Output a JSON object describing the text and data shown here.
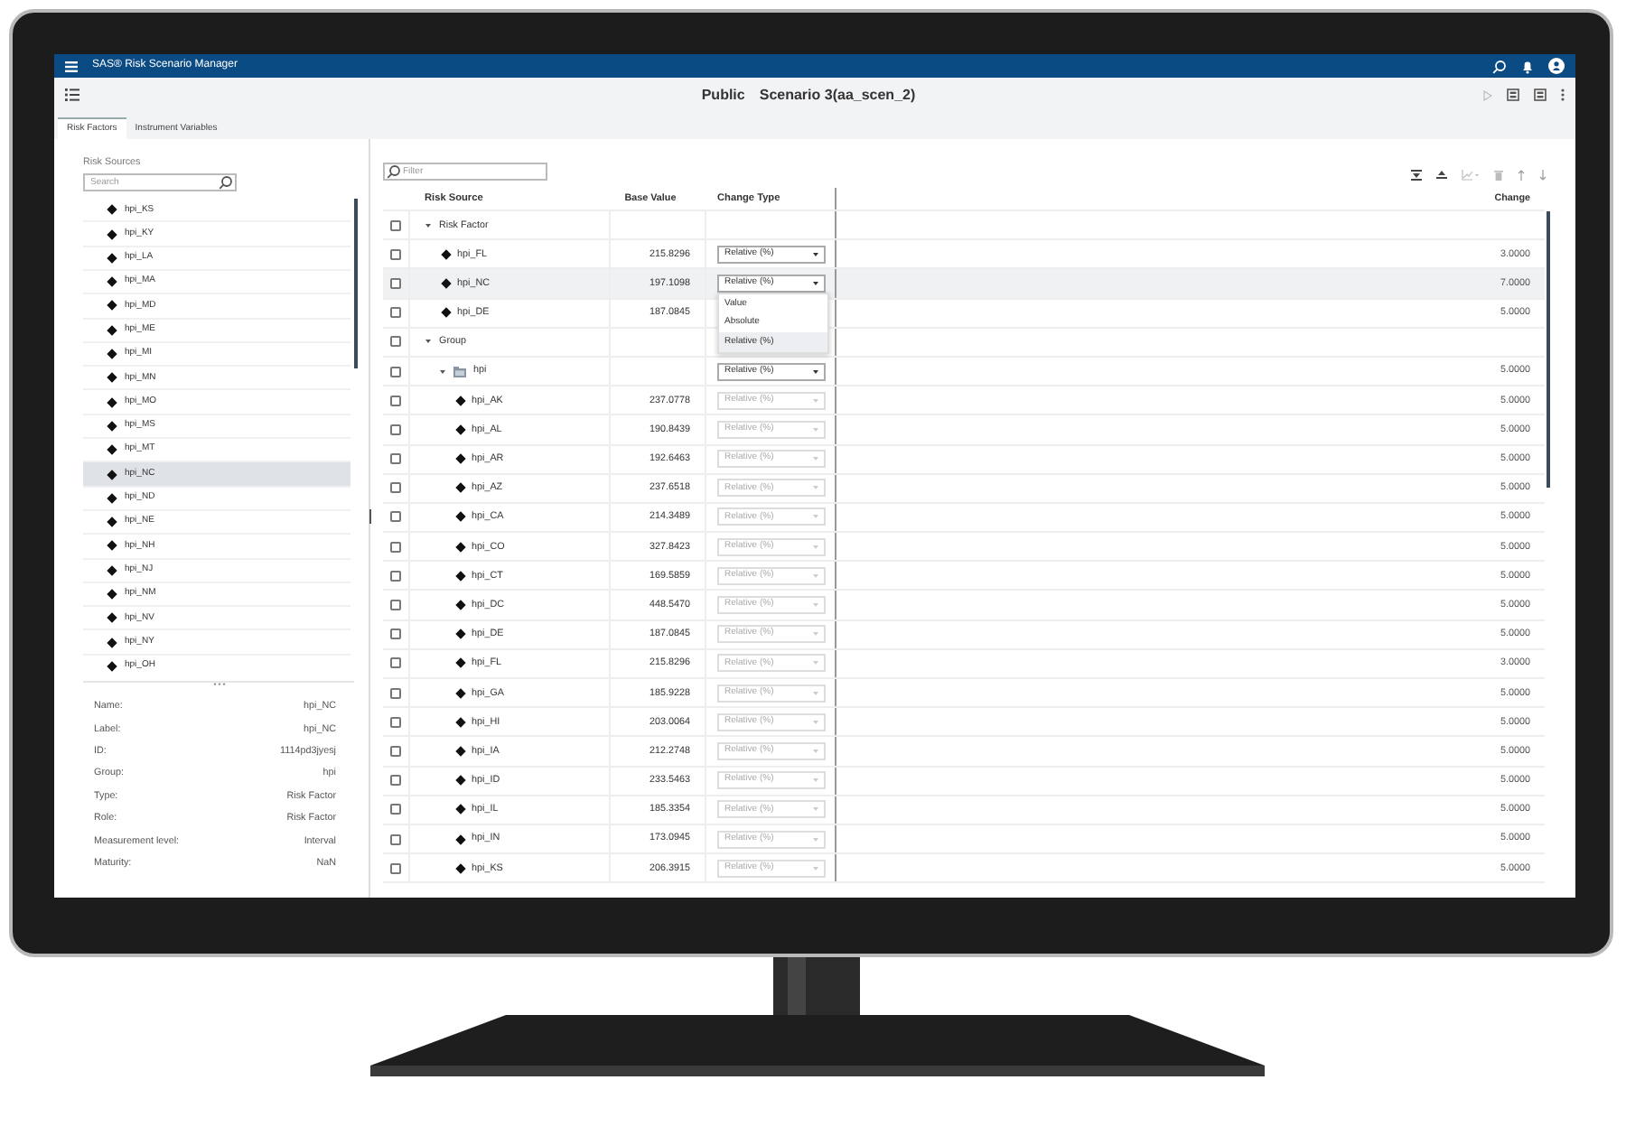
{
  "app_bar": {
    "title": "SAS® Risk Scenario Manager"
  },
  "header": {
    "visibility": "Public",
    "title": "Scenario 3(aa_scen_2)"
  },
  "tabs": [
    {
      "label": "Risk Factors",
      "selected": true
    },
    {
      "label": "Instrument Variables",
      "selected": false
    }
  ],
  "risk_sources": {
    "heading": "Risk Sources",
    "search": {
      "placeholder": "Search"
    },
    "items": [
      {
        "label": "hpi_KS",
        "selected": false
      },
      {
        "label": "hpi_KY",
        "selected": false
      },
      {
        "label": "hpi_LA",
        "selected": false
      },
      {
        "label": "hpi_MA",
        "selected": false
      },
      {
        "label": "hpi_MD",
        "selected": false
      },
      {
        "label": "hpi_ME",
        "selected": false
      },
      {
        "label": "hpi_MI",
        "selected": false
      },
      {
        "label": "hpi_MN",
        "selected": false
      },
      {
        "label": "hpi_MO",
        "selected": false
      },
      {
        "label": "hpi_MS",
        "selected": false
      },
      {
        "label": "hpi_MT",
        "selected": false
      },
      {
        "label": "hpi_NC",
        "selected": true
      },
      {
        "label": "hpi_ND",
        "selected": false
      },
      {
        "label": "hpi_NE",
        "selected": false
      },
      {
        "label": "hpi_NH",
        "selected": false
      },
      {
        "label": "hpi_NJ",
        "selected": false
      },
      {
        "label": "hpi_NM",
        "selected": false
      },
      {
        "label": "hpi_NV",
        "selected": false
      },
      {
        "label": "hpi_NY",
        "selected": false
      },
      {
        "label": "hpi_OH",
        "selected": false
      }
    ]
  },
  "details": [
    {
      "label": "Name:",
      "value": "hpi_NC"
    },
    {
      "label": "Label:",
      "value": "hpi_NC"
    },
    {
      "label": "ID:",
      "value": "1114pd3jyesj"
    },
    {
      "label": "Group:",
      "value": "hpi"
    },
    {
      "label": "Type:",
      "value": "Risk Factor"
    },
    {
      "label": "Role:",
      "value": "Risk Factor"
    },
    {
      "label": "Measurement level:",
      "value": "Interval"
    },
    {
      "label": "Maturity:",
      "value": "NaN"
    }
  ],
  "grid": {
    "filter": {
      "placeholder": "Filter"
    },
    "columns": [
      "Risk Source",
      "Base Value",
      "Change Type",
      "Change"
    ],
    "rows": [
      {
        "kind": "category",
        "label": "Risk Factor",
        "checked": false,
        "selected": false,
        "expanded": true,
        "children": [
          {
            "kind": "item",
            "label": "hpi_FL",
            "base_value": "215.8296",
            "change_type": {
              "value": "Relative (%)",
              "disabled": false
            },
            "change": "3.0000",
            "checked": false,
            "selected": false
          },
          {
            "kind": "item",
            "label": "hpi_NC",
            "base_value": "197.1098",
            "change_type": {
              "value": "Relative (%)",
              "disabled": false,
              "options": [
                {
                  "label": "Value",
                  "selected": false
                },
                {
                  "label": "Absolute",
                  "selected": false
                },
                {
                  "label": "Relative (%)",
                  "selected": true
                }
              ]
            },
            "change": "7.0000",
            "checked": false,
            "selected": true
          },
          {
            "kind": "item",
            "label": "hpi_DE",
            "base_value": "187.0845",
            "change": "5.0000",
            "checked": false,
            "selected": false
          }
        ]
      },
      {
        "kind": "category",
        "label": "Group",
        "checked": false,
        "selected": false,
        "expanded": true,
        "children": [
          {
            "kind": "folder",
            "label": "hpi",
            "change_type": {
              "value": "Relative (%)",
              "disabled": false
            },
            "change": "5.0000",
            "checked": false,
            "selected": false,
            "expanded": true,
            "children": [
              {
                "kind": "item",
                "label": "hpi_AK",
                "base_value": "237.0778",
                "change_type": {
                  "value": "Relative (%)",
                  "disabled": true
                },
                "change": "5.0000",
                "checked": false,
                "selected": false
              },
              {
                "kind": "item",
                "label": "hpi_AL",
                "base_value": "190.8439",
                "change_type": {
                  "value": "Relative (%)",
                  "disabled": true
                },
                "change": "5.0000",
                "checked": false,
                "selected": false
              },
              {
                "kind": "item",
                "label": "hpi_AR",
                "base_value": "192.6463",
                "change_type": {
                  "value": "Relative (%)",
                  "disabled": true
                },
                "change": "5.0000",
                "checked": false,
                "selected": false
              },
              {
                "kind": "item",
                "label": "hpi_AZ",
                "base_value": "237.6518",
                "change_type": {
                  "value": "Relative (%)",
                  "disabled": true
                },
                "change": "5.0000",
                "checked": false,
                "selected": false
              },
              {
                "kind": "item",
                "label": "hpi_CA",
                "base_value": "214.3489",
                "change_type": {
                  "value": "Relative (%)",
                  "disabled": true
                },
                "change": "5.0000",
                "checked": false,
                "selected": false
              },
              {
                "kind": "item",
                "label": "hpi_CO",
                "base_value": "327.8423",
                "change_type": {
                  "value": "Relative (%)",
                  "disabled": true
                },
                "change": "5.0000",
                "checked": false,
                "selected": false
              },
              {
                "kind": "item",
                "label": "hpi_CT",
                "base_value": "169.5859",
                "change_type": {
                  "value": "Relative (%)",
                  "disabled": true
                },
                "change": "5.0000",
                "checked": false,
                "selected": false
              },
              {
                "kind": "item",
                "label": "hpi_DC",
                "base_value": "448.5470",
                "change_type": {
                  "value": "Relative (%)",
                  "disabled": true
                },
                "change": "5.0000",
                "checked": false,
                "selected": false
              },
              {
                "kind": "item",
                "label": "hpi_DE",
                "base_value": "187.0845",
                "change_type": {
                  "value": "Relative (%)",
                  "disabled": true
                },
                "change": "5.0000",
                "checked": false,
                "selected": false
              },
              {
                "kind": "item",
                "label": "hpi_FL",
                "base_value": "215.8296",
                "change_type": {
                  "value": "Relative (%)",
                  "disabled": true
                },
                "change": "3.0000",
                "checked": false,
                "selected": false
              },
              {
                "kind": "item",
                "label": "hpi_GA",
                "base_value": "185.9228",
                "change_type": {
                  "value": "Relative (%)",
                  "disabled": true
                },
                "change": "5.0000",
                "checked": false,
                "selected": false
              },
              {
                "kind": "item",
                "label": "hpi_HI",
                "base_value": "203.0064",
                "change_type": {
                  "value": "Relative (%)",
                  "disabled": true
                },
                "change": "5.0000",
                "checked": false,
                "selected": false
              },
              {
                "kind": "item",
                "label": "hpi_IA",
                "base_value": "212.2748",
                "change_type": {
                  "value": "Relative (%)",
                  "disabled": true
                },
                "change": "5.0000",
                "checked": false,
                "selected": false
              },
              {
                "kind": "item",
                "label": "hpi_ID",
                "base_value": "233.5463",
                "change_type": {
                  "value": "Relative (%)",
                  "disabled": true
                },
                "change": "5.0000",
                "checked": false,
                "selected": false
              },
              {
                "kind": "item",
                "label": "hpi_IL",
                "base_value": "185.3354",
                "change_type": {
                  "value": "Relative (%)",
                  "disabled": true
                },
                "change": "5.0000",
                "checked": false,
                "selected": false
              },
              {
                "kind": "item",
                "label": "hpi_IN",
                "base_value": "173.0945",
                "change_type": {
                  "value": "Relative (%)",
                  "disabled": true
                },
                "change": "5.0000",
                "checked": false,
                "selected": false
              },
              {
                "kind": "item",
                "label": "hpi_KS",
                "base_value": "206.3915",
                "change_type": {
                  "value": "Relative (%)",
                  "disabled": true
                },
                "change": "5.0000",
                "checked": false,
                "selected": false
              }
            ]
          }
        ]
      }
    ]
  }
}
